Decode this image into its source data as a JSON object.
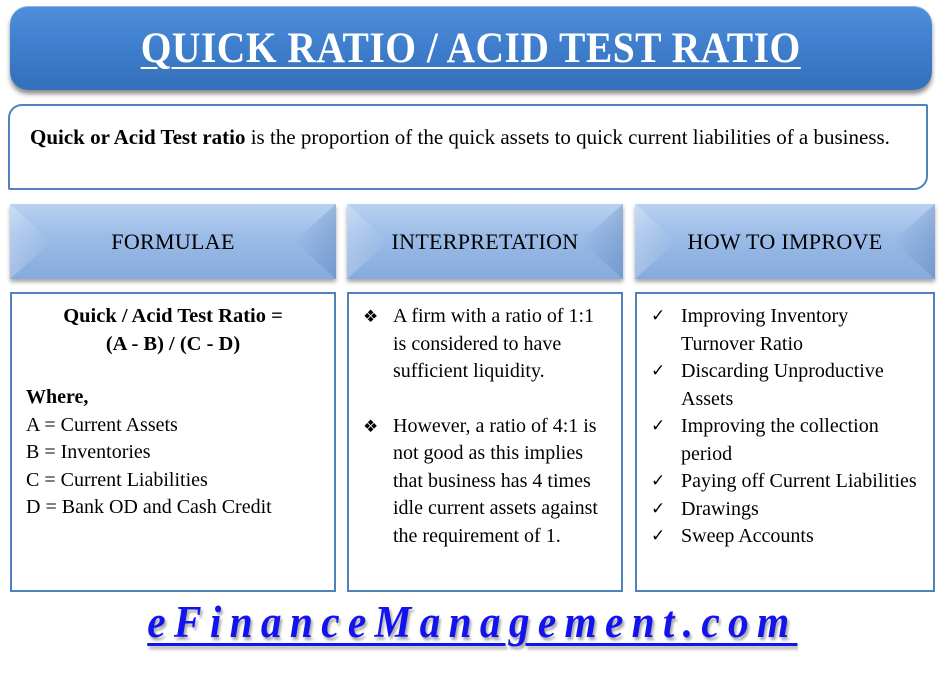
{
  "title": "QUICK RATIO / ACID TEST RATIO",
  "definition": {
    "bold_term": "Quick or Acid Test ratio",
    "text": " is the proportion of the quick assets to quick current liabilities of a business."
  },
  "sections": {
    "formulae": {
      "header": "FORMULAE",
      "formula_line1": "Quick / Acid Test Ratio =",
      "formula_line2": "(A - B) / (C - D)",
      "where_label": "Where,",
      "definitions": [
        "A = Current Assets",
        "B = Inventories",
        "C = Current Liabilities",
        "D =  Bank OD and Cash Credit"
      ]
    },
    "interpretation": {
      "header": "INTERPRETATION",
      "bullet_icon": "❖",
      "points": [
        "A firm with a ratio of 1:1 is considered to have sufficient liquidity.",
        "However, a ratio of 4:1 is not good as this implies that business has 4 times idle current assets against the requirement of 1."
      ]
    },
    "improve": {
      "header": "HOW TO IMPROVE",
      "check_icon": "✓",
      "items": [
        "Improving Inventory Turnover Ratio",
        "Discarding Unproductive Assets",
        "Improving the collection period",
        "Paying off Current Liabilities",
        "Drawings",
        "Sweep Accounts"
      ]
    }
  },
  "footer": {
    "site": "eFinanceManagement.com"
  },
  "colors": {
    "title_bg": "#3f7fcd",
    "border": "#4f81bd",
    "header_bg": "#9dbde8",
    "footer_link": "#1313ee"
  }
}
